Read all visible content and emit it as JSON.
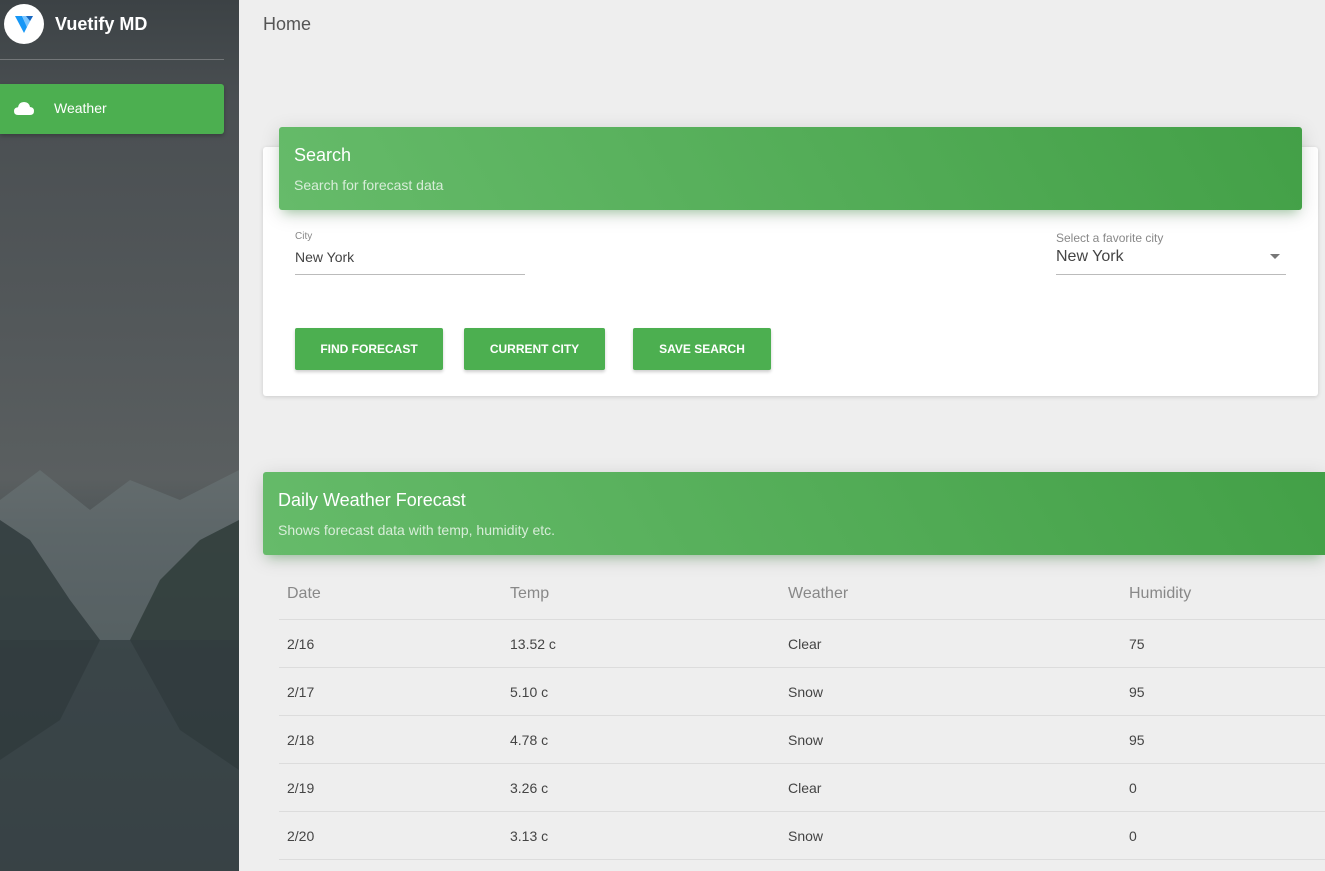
{
  "app": {
    "title": "Vuetify MD",
    "logo_icon": "vuetify-logo-icon"
  },
  "sidebar": {
    "items": [
      {
        "label": "Weather",
        "icon": "cloud-icon",
        "active": true
      }
    ]
  },
  "toolbar": {
    "title": "Home"
  },
  "search_card": {
    "title": "Search",
    "subtitle": "Search for forecast data",
    "city_field": {
      "label": "City",
      "value": "New York"
    },
    "favorite_select": {
      "label": "Select a favorite city",
      "value": "New York"
    },
    "buttons": {
      "find": "FIND FORECAST",
      "current": "CURRENT CITY",
      "save": "SAVE SEARCH"
    }
  },
  "forecast": {
    "title": "Daily Weather Forecast",
    "subtitle": "Shows forecast data with temp, humidity etc.",
    "columns": [
      "Date",
      "Temp",
      "Weather",
      "Humidity"
    ],
    "rows": [
      [
        "2/16",
        "13.52 c",
        "Clear",
        "75"
      ],
      [
        "2/17",
        "5.10 c",
        "Snow",
        "95"
      ],
      [
        "2/18",
        "4.78 c",
        "Snow",
        "95"
      ],
      [
        "2/19",
        "3.26 c",
        "Clear",
        "0"
      ],
      [
        "2/20",
        "3.13 c",
        "Snow",
        "0"
      ]
    ]
  },
  "colors": {
    "accent": "#4caf50",
    "background": "#eeeeee"
  }
}
